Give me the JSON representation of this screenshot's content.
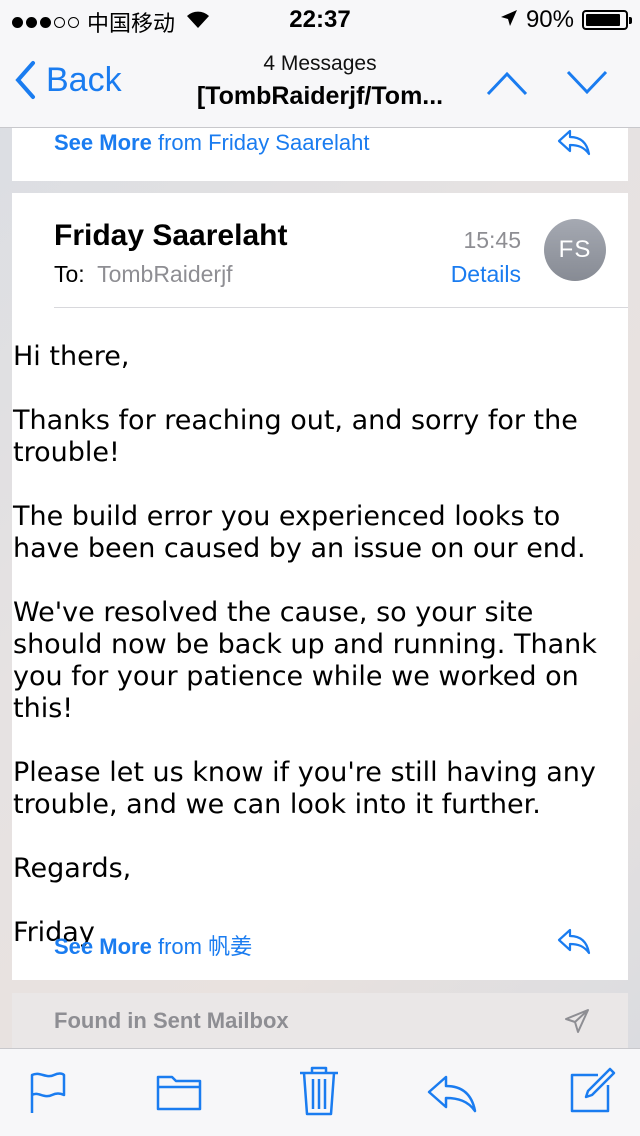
{
  "status_bar": {
    "carrier": "中国移动",
    "time": "22:37",
    "battery": "90%",
    "battery_level": 0.9,
    "signal_bars": 3
  },
  "nav": {
    "back_label": "Back",
    "message_count": "4 Messages",
    "subject": "[TombRaiderjf/Tom..."
  },
  "previous_message": {
    "see_more_label": "See More",
    "from_text": "from Friday Saarelaht"
  },
  "message": {
    "sender": "Friday Saarelaht",
    "to_label": "To:",
    "to_value": "TombRaiderjf",
    "time": "15:45",
    "details_label": "Details",
    "avatar_initials": "FS",
    "body": {
      "greeting": "Hi there,",
      "paragraph1": "Thanks for reaching out, and sorry for the trouble!",
      "paragraph2": "The build error you experienced looks to have been caused by an issue on our end.",
      "paragraph3": "We've resolved the cause, so your site should now be back up and running. Thank you for your patience while we worked on this!",
      "paragraph4": "Please let us know if you're still having any trouble, and we can look into it further.",
      "sign_off": "Regards,",
      "signature": "Friday"
    }
  },
  "next_message": {
    "see_more_label": "See More",
    "from_text": "from 帆姜"
  },
  "sent_mailbox": {
    "label": "Found in Sent Mailbox"
  },
  "toolbar": {
    "icons": [
      "flag-icon",
      "folder-icon",
      "trash-icon",
      "reply-icon",
      "compose-icon"
    ]
  },
  "colors": {
    "accent": "#1a7cf0",
    "secondary_text": "#8e8e93",
    "avatar_bg": "#999da6"
  }
}
